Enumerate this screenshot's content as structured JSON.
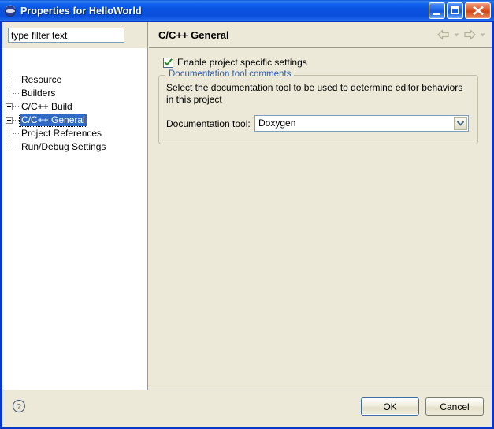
{
  "window": {
    "title": "Properties for HelloWorld",
    "icon": "eclipse-globe-icon",
    "buttons": {
      "minimize": "minimize-button",
      "maximize": "maximize-button",
      "close": "close-button"
    }
  },
  "left_pane": {
    "filter": {
      "value": "type filter text",
      "placeholder": "type filter text"
    },
    "tree": [
      {
        "label": "Resource",
        "expandable": false,
        "selected": false
      },
      {
        "label": "Builders",
        "expandable": false,
        "selected": false
      },
      {
        "label": "C/C++ Build",
        "expandable": true,
        "selected": false
      },
      {
        "label": "C/C++ General",
        "expandable": true,
        "selected": true
      },
      {
        "label": "Project References",
        "expandable": false,
        "selected": false
      },
      {
        "label": "Run/Debug Settings",
        "expandable": false,
        "selected": false
      }
    ]
  },
  "right_pane": {
    "page_title": "C/C++ General",
    "nav": {
      "back": "back-arrow-icon",
      "back_menu": "back-dropdown-icon",
      "forward": "forward-arrow-icon",
      "forward_menu": "forward-dropdown-icon"
    },
    "enable_checkbox": {
      "label": "Enable project specific settings",
      "checked": true
    },
    "group": {
      "title": "Documentation tool comments",
      "description": "Select the documentation tool to be used to determine editor behaviors in this project",
      "field_label": "Documentation tool:",
      "combo_value": "Doxygen"
    }
  },
  "footer": {
    "help": "help-icon",
    "ok_label": "OK",
    "cancel_label": "Cancel"
  },
  "colors": {
    "title_blue": "#0a53e0",
    "frame_blue": "#0a36c8",
    "dialog_bg": "#ece9d8",
    "selection_blue": "#316ac5",
    "group_title_blue": "#2a5db0",
    "check_green": "#1f8a1f",
    "close_red": "#e05a2a"
  }
}
